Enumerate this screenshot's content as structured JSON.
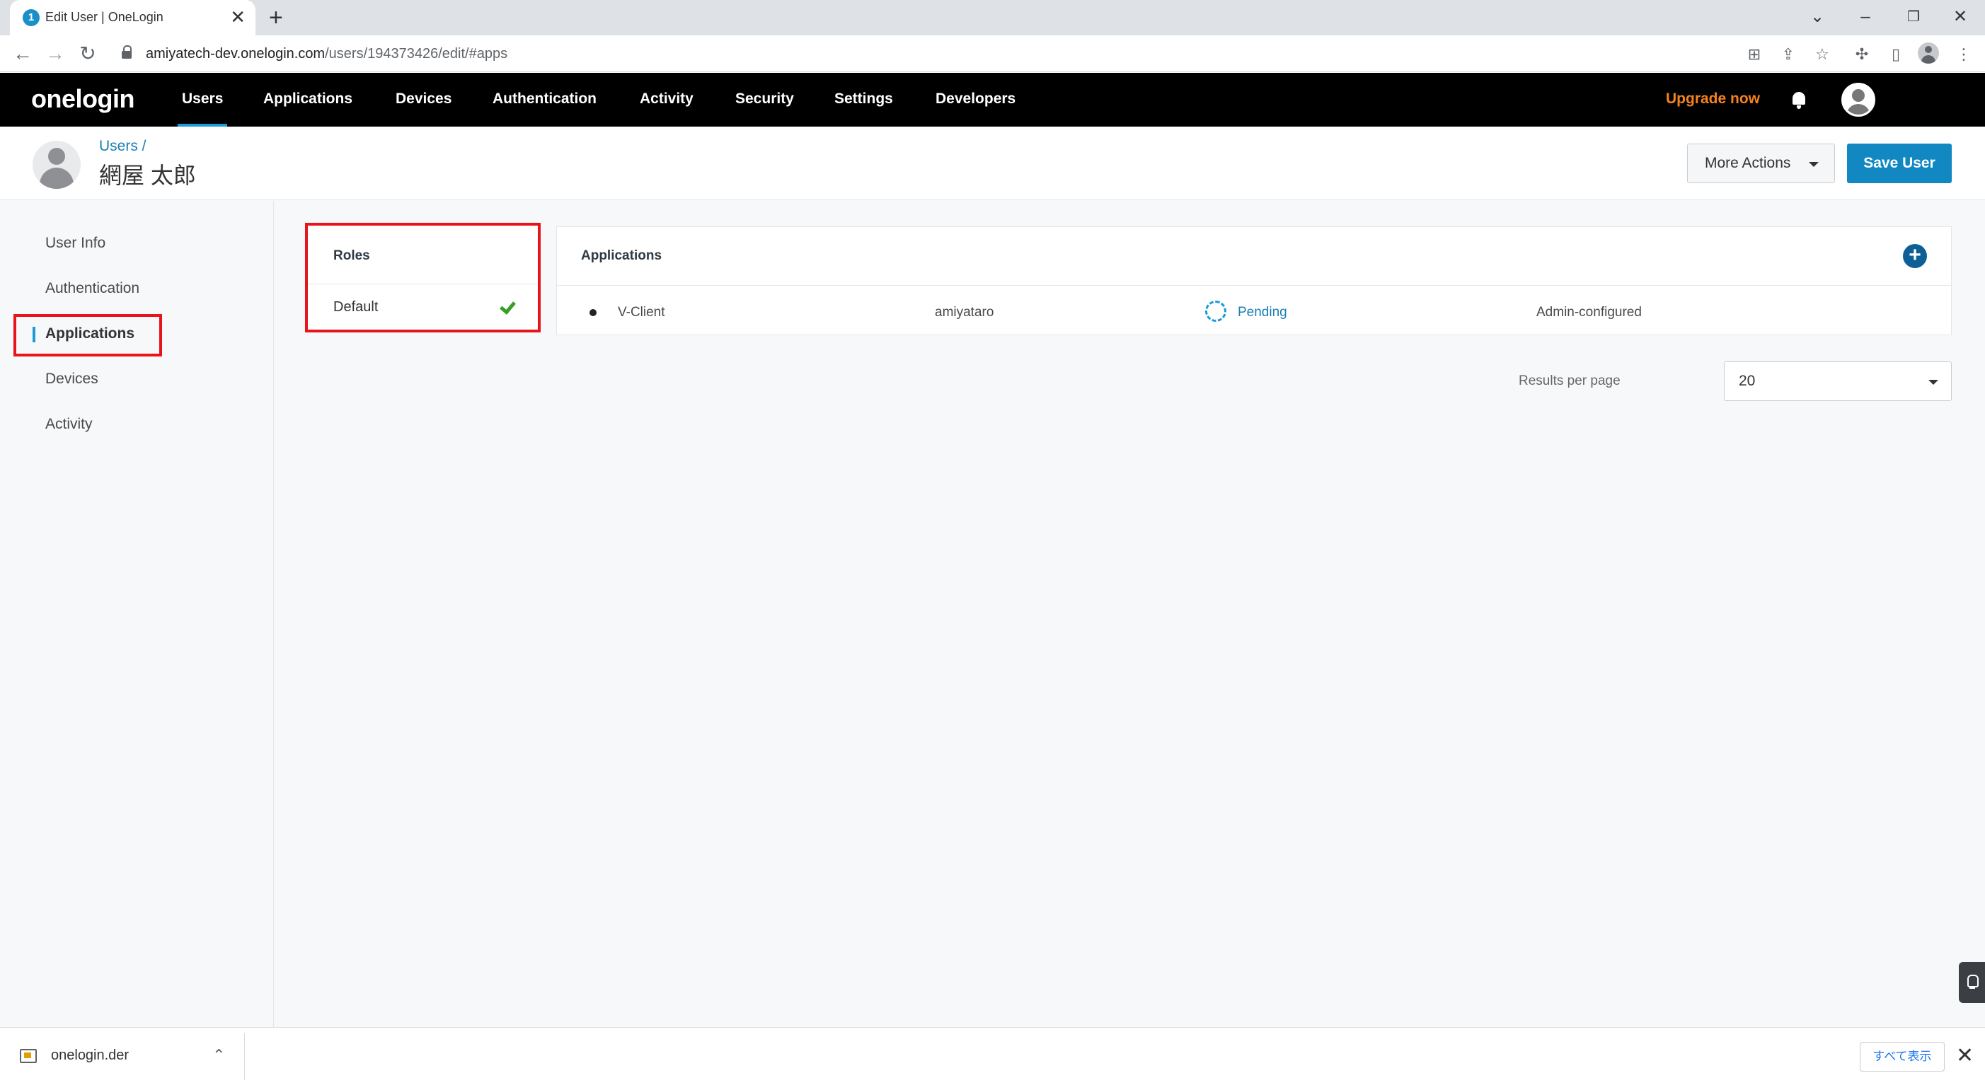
{
  "browser": {
    "tab_favicon_letter": "1",
    "tab_title": "Edit User | OneLogin",
    "tab_close": "✕",
    "new_tab": "+",
    "url_host": "amiyatech-dev.onelogin.com",
    "url_path": "/users/194373426/edit/#apps",
    "icons": [
      "back-icon",
      "forward-icon",
      "reload-icon",
      "lock-icon",
      "translate-icon",
      "share-icon",
      "star-icon",
      "extensions-icon",
      "side-panel-icon",
      "profile-icon",
      "menu-icon"
    ]
  },
  "appnav": {
    "logo": "onelogin",
    "items": [
      "Users",
      "Applications",
      "Devices",
      "Authentication",
      "Activity",
      "Security",
      "Settings",
      "Developers"
    ],
    "active": "Users",
    "upgrade": "Upgrade now"
  },
  "header": {
    "breadcrumb": "Users /",
    "user_name": "網屋 太郎",
    "more_actions": "More Actions",
    "save_user": "Save User"
  },
  "sidebar": {
    "items": [
      "User Info",
      "Authentication",
      "Applications",
      "Devices",
      "Activity"
    ],
    "active": "Applications"
  },
  "roles": {
    "title": "Roles",
    "items": [
      {
        "name": "Default",
        "checked": true
      }
    ]
  },
  "applications": {
    "title": "Applications",
    "add_icon": "+",
    "rows": [
      {
        "app": "V-Client",
        "login": "amiyataro",
        "status": "Pending",
        "provisioning": "Admin-configured"
      }
    ],
    "results_per_page_label": "Results per page",
    "results_per_page_value": "20"
  },
  "download_bar": {
    "file_name": "onelogin.der",
    "show_all": "すべて表示",
    "close": "✕"
  },
  "colors": {
    "accent": "#1c9bd8",
    "save_button": "#1288c3",
    "upgrade": "#f5821f",
    "highlight": "#e8141b",
    "check": "#37a024"
  }
}
